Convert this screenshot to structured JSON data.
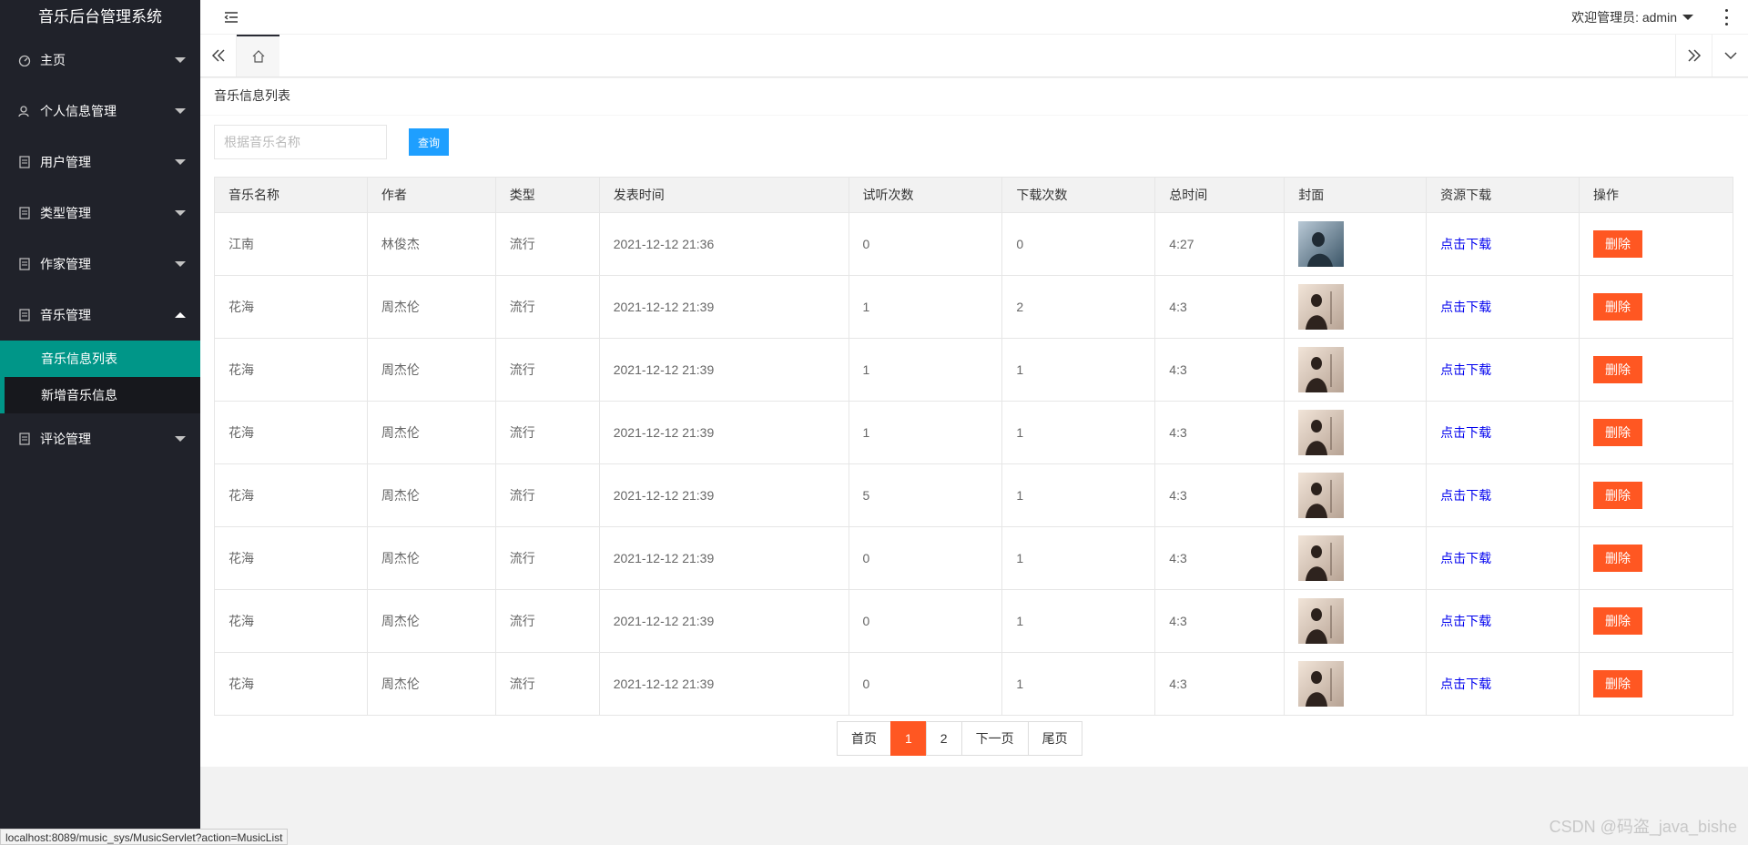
{
  "app": {
    "title": "音乐后台管理系统"
  },
  "sidebar": {
    "items": [
      {
        "label": "主页",
        "icon": "dashboard-icon",
        "expanded": false
      },
      {
        "label": "个人信息管理",
        "icon": "user-icon",
        "expanded": false
      },
      {
        "label": "用户管理",
        "icon": "file-icon",
        "expanded": false
      },
      {
        "label": "类型管理",
        "icon": "file-icon",
        "expanded": false
      },
      {
        "label": "作家管理",
        "icon": "file-icon",
        "expanded": false
      },
      {
        "label": "音乐管理",
        "icon": "file-icon",
        "expanded": true
      },
      {
        "label": "评论管理",
        "icon": "file-icon",
        "expanded": false
      }
    ],
    "subitems": [
      {
        "label": "音乐信息列表",
        "active": true
      },
      {
        "label": "新增音乐信息",
        "active": false
      }
    ]
  },
  "header": {
    "welcome": "欢迎管理员: admin"
  },
  "content": {
    "title": "音乐信息列表",
    "search_placeholder": "根据音乐名称",
    "search_button": "查询",
    "columns": [
      "音乐名称",
      "作者",
      "类型",
      "发表时间",
      "试听次数",
      "下载次数",
      "总时间",
      "封面",
      "资源下载",
      "操作"
    ],
    "rows": [
      {
        "name": "江南",
        "author": "林俊杰",
        "genre": "流行",
        "time": "2021-12-12 21:36",
        "plays": "0",
        "downloads": "0",
        "duration": "4:27",
        "cover": "cover-blue",
        "download_label": "点击下载",
        "delete_label": "删除"
      },
      {
        "name": "花海",
        "author": "周杰伦",
        "genre": "流行",
        "time": "2021-12-12 21:39",
        "plays": "1",
        "downloads": "2",
        "duration": "4:3",
        "cover": "cover-sepia",
        "download_label": "点击下载",
        "delete_label": "删除"
      },
      {
        "name": "花海",
        "author": "周杰伦",
        "genre": "流行",
        "time": "2021-12-12 21:39",
        "plays": "1",
        "downloads": "1",
        "duration": "4:3",
        "cover": "cover-sepia",
        "download_label": "点击下载",
        "delete_label": "删除"
      },
      {
        "name": "花海",
        "author": "周杰伦",
        "genre": "流行",
        "time": "2021-12-12 21:39",
        "plays": "1",
        "downloads": "1",
        "duration": "4:3",
        "cover": "cover-sepia",
        "download_label": "点击下载",
        "delete_label": "删除"
      },
      {
        "name": "花海",
        "author": "周杰伦",
        "genre": "流行",
        "time": "2021-12-12 21:39",
        "plays": "5",
        "downloads": "1",
        "duration": "4:3",
        "cover": "cover-sepia",
        "download_label": "点击下载",
        "delete_label": "删除"
      },
      {
        "name": "花海",
        "author": "周杰伦",
        "genre": "流行",
        "time": "2021-12-12 21:39",
        "plays": "0",
        "downloads": "1",
        "duration": "4:3",
        "cover": "cover-sepia",
        "download_label": "点击下载",
        "delete_label": "删除"
      },
      {
        "name": "花海",
        "author": "周杰伦",
        "genre": "流行",
        "time": "2021-12-12 21:39",
        "plays": "0",
        "downloads": "1",
        "duration": "4:3",
        "cover": "cover-sepia",
        "download_label": "点击下载",
        "delete_label": "删除"
      },
      {
        "name": "花海",
        "author": "周杰伦",
        "genre": "流行",
        "time": "2021-12-12 21:39",
        "plays": "0",
        "downloads": "1",
        "duration": "4:3",
        "cover": "cover-sepia",
        "download_label": "点击下载",
        "delete_label": "删除"
      }
    ],
    "pager": [
      {
        "label": "首页",
        "current": false
      },
      {
        "label": "1",
        "current": true
      },
      {
        "label": "2",
        "current": false
      },
      {
        "label": "下一页",
        "current": false
      },
      {
        "label": "尾页",
        "current": false
      }
    ]
  },
  "statusbar": {
    "url": "localhost:8089/music_sys/MusicServlet?action=MusicList"
  },
  "watermark": "CSDN @码盗_java_bishe",
  "colors": {
    "sidebar_bg": "#20222a",
    "active_green": "#009688",
    "primary_blue": "#1e9fff",
    "danger_orange": "#ff5722"
  }
}
